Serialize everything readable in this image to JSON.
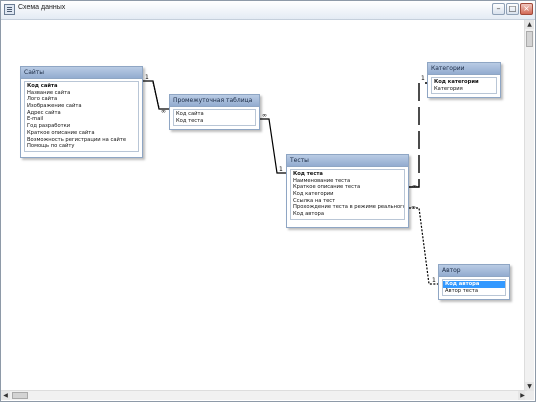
{
  "window": {
    "title": "Схема данных"
  },
  "tables": {
    "sites": {
      "title": "Сайты",
      "fields": [
        {
          "name": "Код сайта",
          "key": true
        },
        {
          "name": "Название сайта"
        },
        {
          "name": "Лого сайта"
        },
        {
          "name": "Изображение сайта"
        },
        {
          "name": "Адрес сайта"
        },
        {
          "name": "E-mail"
        },
        {
          "name": "Год разработки"
        },
        {
          "name": "Краткое описание сайта"
        },
        {
          "name": "Возможность регистрации на сайте"
        },
        {
          "name": "Помощь по сайту"
        }
      ]
    },
    "link": {
      "title": "Промежуточная таблица",
      "fields": [
        {
          "name": "Код сайта"
        },
        {
          "name": "Код теста"
        }
      ]
    },
    "tests": {
      "title": "Тесты",
      "fields": [
        {
          "name": "Код теста",
          "key": true
        },
        {
          "name": "Наименование теста"
        },
        {
          "name": "Краткое описание теста"
        },
        {
          "name": "Код категории"
        },
        {
          "name": "Ссылка на тест"
        },
        {
          "name": "Прохождение теста в режиме реального времени"
        },
        {
          "name": "Код автора"
        }
      ]
    },
    "categories": {
      "title": "Категории",
      "fields": [
        {
          "name": "Код категории",
          "key": true
        },
        {
          "name": "Категория"
        }
      ]
    },
    "authors": {
      "title": "Автор",
      "fields": [
        {
          "name": "Код автора",
          "key": true,
          "selected": true
        },
        {
          "name": "Автор теста"
        }
      ]
    }
  },
  "relations": {
    "one": "1",
    "many": "∞"
  }
}
